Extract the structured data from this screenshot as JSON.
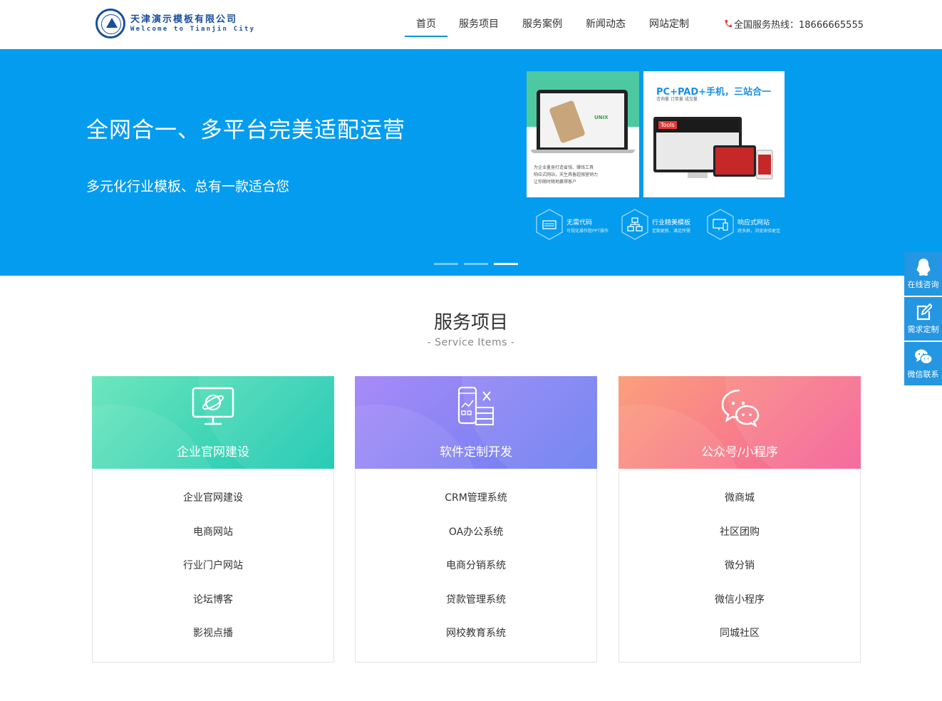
{
  "header": {
    "logo_cn": "天津演示模板有限公司",
    "logo_en": "Welcome to Tianjin City",
    "nav": [
      "首页",
      "服务项目",
      "服务案例",
      "新闻动态",
      "网站定制"
    ],
    "hotline": "全国服务热线：18666665555"
  },
  "banner": {
    "title": "全网合一、多平台完美适配运营",
    "subtitle": "多元化行业模板、总有一款适合您",
    "card_a": {
      "logo": "UNIX",
      "lines": [
        "为企业量身打造省钱、赚钱工具",
        "响应式网站，天生具备超强营销力",
        "让你随时随地赢得客户"
      ]
    },
    "card_b": {
      "title": "PC+PAD+手机，三站合一",
      "tags": "咨询量   订单量   成交量",
      "tools": "Tools"
    },
    "features": [
      {
        "name": "无需代码",
        "desc": "可视化操作胜PPT操作"
      },
      {
        "name": "行业精美模板",
        "desc": "定期更新，满足所需"
      },
      {
        "name": "响应式网站",
        "desc": "跨多屏，浏览体验更佳"
      }
    ],
    "active_slide": 3,
    "slide_count": 3
  },
  "section": {
    "title": "服务项目",
    "subtitle": "- Service Items -"
  },
  "services": [
    {
      "name": "企业官网建设",
      "icon": "web-globe-icon",
      "gradient": [
        "#6ee6bd",
        "#17c7b0"
      ],
      "items": [
        "企业官网建设",
        "电商网站",
        "行业门户网站",
        "论坛博客",
        "影视点播"
      ]
    },
    {
      "name": "软件定制开发",
      "icon": "software-dev-icon",
      "gradient": [
        "#a78bf8",
        "#6a7ef0"
      ],
      "items": [
        "CRM管理系统",
        "OA办公系统",
        "电商分销系统",
        "贷款管理系统",
        "网校教育系统"
      ]
    },
    {
      "name": "公众号/小程序",
      "icon": "wechat-chat-icon",
      "gradient": [
        "#fb9f7c",
        "#f55f98"
      ],
      "items": [
        "微商城",
        "社区团购",
        "微分销",
        "微信小程序",
        "同城社区"
      ]
    }
  ],
  "float_bar": [
    {
      "label": "在线咨询",
      "icon": "qq-icon"
    },
    {
      "label": "需求定制",
      "icon": "edit-icon"
    },
    {
      "label": "微信联系",
      "icon": "wechat-icon"
    }
  ],
  "colors": {
    "banner_bg": "#049cef",
    "nav_active": "#0b97d8",
    "float_bg": "#2596e1"
  }
}
